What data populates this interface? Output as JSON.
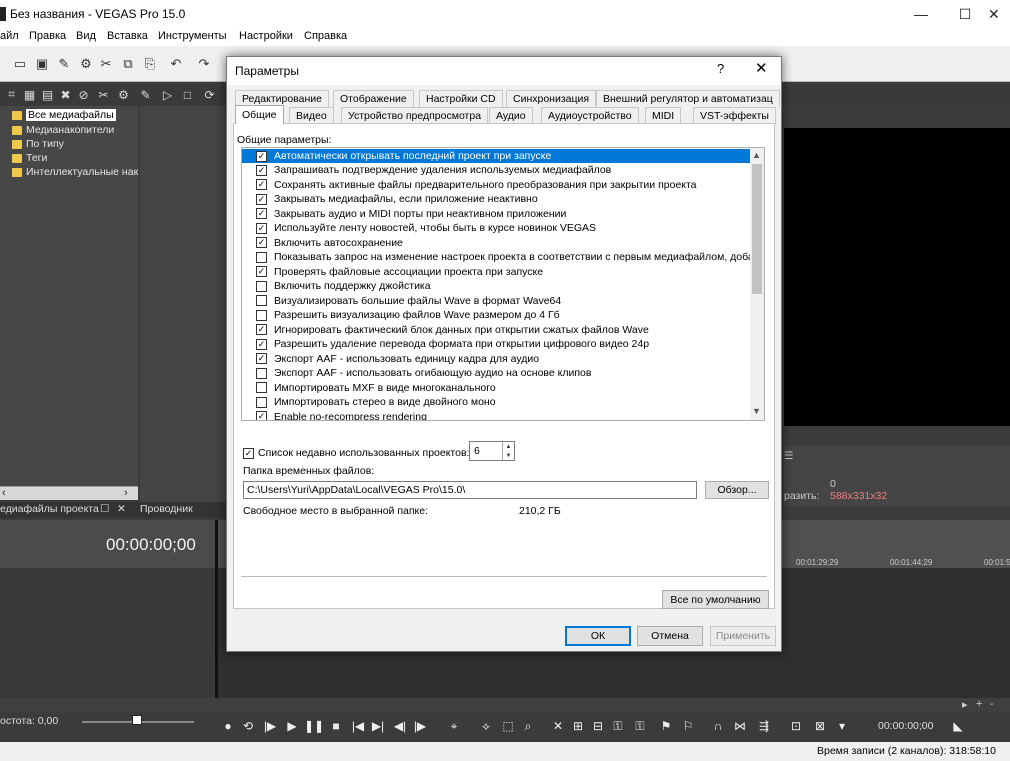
{
  "app": {
    "title": "Без названия - VEGAS Pro 15.0",
    "window_controls": {
      "minimize": "—",
      "maximize": "☐",
      "close": "✕"
    }
  },
  "menubar": {
    "items": [
      "айл",
      "Правка",
      "Вид",
      "Вставка",
      "Инструменты",
      "Настройки",
      "Справка"
    ]
  },
  "explorer": {
    "tree": [
      {
        "label": "Все медиафайлы",
        "selected": true
      },
      {
        "label": "Медианакопители"
      },
      {
        "label": "По типу"
      },
      {
        "label": "Теги"
      },
      {
        "label": "Интеллектуальные нак"
      }
    ],
    "tabs": [
      "едиафайлы проекта",
      "Проводник"
    ],
    "tab_icons": {
      "dock": "☐",
      "close": "✕"
    }
  },
  "timeline": {
    "timecode": "00:00:00;00",
    "ruler_labels": [
      "00:01:29;29",
      "00:01:44;29",
      "00:01:5"
    ],
    "rate_label": "остота: 0,00",
    "record_time": "00:00:00;00"
  },
  "preview": {
    "values": [
      "0",
      "588x331x32"
    ],
    "label": "разить:"
  },
  "status": {
    "text": "Время записи (2 каналов): 318:58:10"
  },
  "dialog": {
    "title": "Параметры",
    "help": "?",
    "close": "✕",
    "tabs_row1": [
      "Редактирование",
      "Отображение",
      "Настройки CD",
      "Синхронизация",
      "Внешний регулятор и автоматизац"
    ],
    "tabs_row2": [
      "Общие",
      "Видео",
      "Устройство предпросмотра",
      "Аудио",
      "Аудиоустройство",
      "MIDI",
      "VST-эффекты"
    ],
    "active_tab": "Общие",
    "group_label": "Общие параметры:",
    "options": [
      {
        "label": "Автоматически открывать последний проект при запуске",
        "checked": true,
        "selected": true
      },
      {
        "label": "Запрашивать подтверждение удаления используемых медиафайлов",
        "checked": true
      },
      {
        "label": "Сохранять активные файлы предварительного преобразования при закрытии проекта",
        "checked": true
      },
      {
        "label": "Закрывать медиафайлы, если приложение неактивно",
        "checked": true
      },
      {
        "label": "Закрывать аудио и MIDI порты при неактивном приложении",
        "checked": true
      },
      {
        "label": "Используйте ленту новостей, чтобы быть в курсе новинок VEGAS",
        "checked": true
      },
      {
        "label": "Включить автосохранение",
        "checked": true
      },
      {
        "label": "Показывать запрос на изменение настроек проекта в соответствии с первым медиафайлом, добавленн",
        "checked": false
      },
      {
        "label": "Проверять файловые ассоциации проекта при запуске",
        "checked": true
      },
      {
        "label": "Включить поддержку джойстика",
        "checked": false
      },
      {
        "label": "Визуализировать большие файлы Wave в формат Wave64",
        "checked": false
      },
      {
        "label": "Разрешить визуализацию файлов Wave размером до 4 Гб",
        "checked": false
      },
      {
        "label": "Игнорировать фактический блок данных при открытии сжатых файлов Wave",
        "checked": true
      },
      {
        "label": "Разрешить удаление перевода формата при открытии цифрового видео 24p",
        "checked": true
      },
      {
        "label": "Экспорт AAF - использовать единицу кадра для аудио",
        "checked": true
      },
      {
        "label": "Экспорт AAF - использовать огибающую аудио на основе клипов",
        "checked": false
      },
      {
        "label": "Импортировать MXF в виде многоканального",
        "checked": false
      },
      {
        "label": "Импортировать стерео в виде двойного моно",
        "checked": false
      },
      {
        "label": "Enable no-recompress rendering",
        "checked": true
      }
    ],
    "recent_projects": {
      "label": "Список недавно использованных проектов:",
      "checked": true,
      "value": "6"
    },
    "temp_folder": {
      "label": "Папка временных файлов:",
      "value": "C:\\Users\\Yuri\\AppData\\Local\\VEGAS Pro\\15.0\\",
      "browse": "Обзор..."
    },
    "free_space": {
      "label": "Свободное место в выбранной папке:",
      "value": "210,2 ГБ"
    },
    "defaults_button": "Все по умолчанию",
    "ok": "ОК",
    "cancel": "Отмена",
    "apply": "Применить"
  }
}
